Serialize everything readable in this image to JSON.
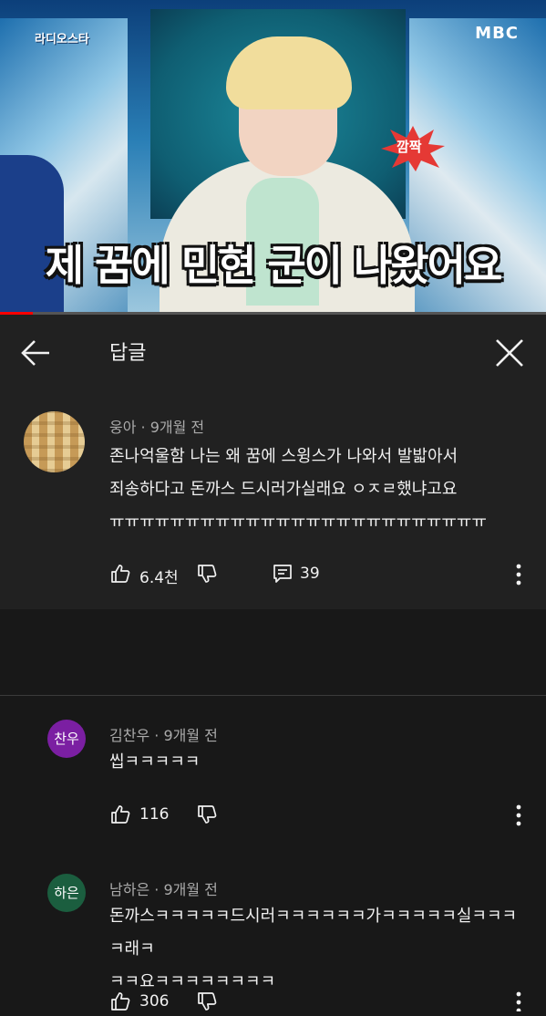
{
  "video": {
    "caption": "제 꿈에 민현 군이 나왔어요",
    "show_logo": "라디오스타",
    "channel_logo": "MBC",
    "sticker_text": "깜짝",
    "progress": 0.06,
    "accent_color": "#ff0000"
  },
  "header": {
    "title": "답글",
    "back_icon": "arrow-left-icon",
    "close_icon": "close-icon"
  },
  "parent_comment": {
    "author": "웅아",
    "time": "9개월 전",
    "text": "존나억울함 나는 왜 꿈에 스윙스가 나와서 발밟아서\n죄송하다고 돈까스 드시러가실래요 ㅇㅈㄹ했냐고요\nㅠㅠㅠㅠㅠㅠㅠㅠㅠㅠㅠㅠㅠㅠㅠㅠㅠㅠㅠㅠㅠㅠㅠㅠㅠ",
    "likes": "6.4천",
    "replies": "39"
  },
  "replies": [
    {
      "author": "김찬우",
      "time": "9개월 전",
      "avatar_text": "찬우",
      "avatar_color": "#7b1fa2",
      "text": "씹ㅋㅋㅋㅋㅋ",
      "likes": "116"
    },
    {
      "author": "남하은",
      "time": "9개월 전",
      "avatar_text": "하은",
      "avatar_color": "#1b5e3f",
      "text": "돈까스ㅋㅋㅋㅋㅋ드시러ㅋㅋㅋㅋㅋㅋ가ㅋㅋㅋㅋㅋ실ㅋㅋㅋㅋ래ㅋ\nㅋㅋ요ㅋㅋㅋㅋㅋㅋㅋㅋ",
      "likes": "306"
    }
  ]
}
